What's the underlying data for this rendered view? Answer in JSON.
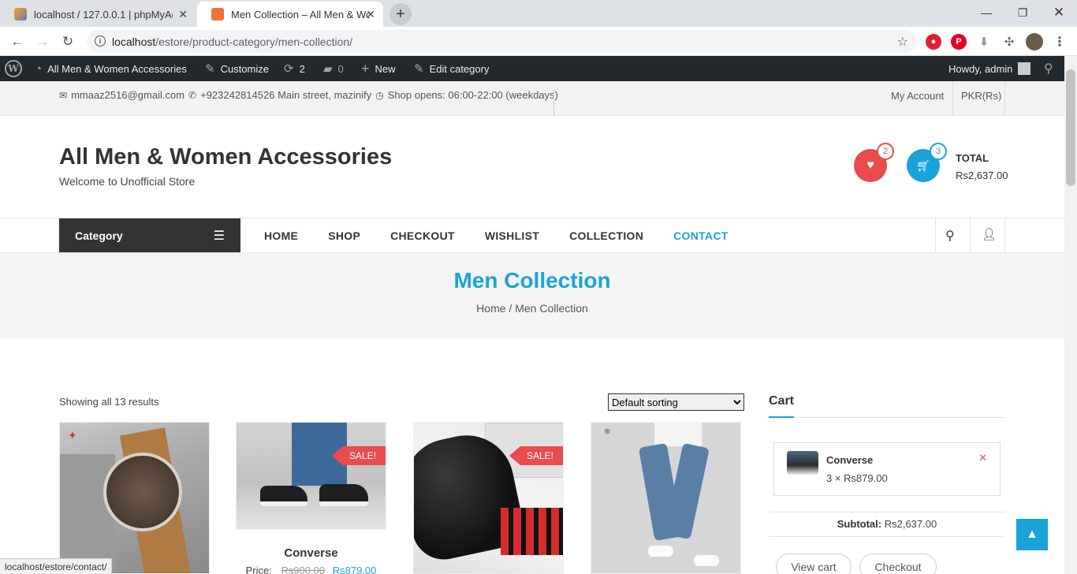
{
  "browser": {
    "tabs": [
      {
        "title": "localhost / 127.0.0.1 | phpMyAdmin",
        "active": false
      },
      {
        "title": "Men Collection – All Men & Women Accessories",
        "active": true
      }
    ],
    "url_host": "localhost",
    "url_path": "/estore/product-category/men-collection/",
    "status_url": "localhost/estore/contact/"
  },
  "adminbar": {
    "site_name": "All Men & Women Accessories",
    "customize": "Customize",
    "updates": "2",
    "comments": "0",
    "new": "New",
    "edit": "Edit category",
    "howdy": "Howdy, admin"
  },
  "topinfo": {
    "email": "mmaaz2516@gmail.com",
    "phone": "+923242814526 Main street, mazinify",
    "hours": "Shop opens: 06:00-22:00 (weekdays)",
    "account": "My Account",
    "currency": "PKR(Rs)"
  },
  "header": {
    "site_title": "All Men & Women Accessories",
    "tagline": "Welcome to Unofficial Store",
    "wishlist_count": "2",
    "cart_count": "3",
    "total_label": "TOTAL",
    "total_value": "Rs2,637.00"
  },
  "nav": {
    "category": "Category",
    "items": [
      "HOME",
      "SHOP",
      "CHECKOUT",
      "WISHLIST",
      "COLLECTION",
      "CONTACT"
    ]
  },
  "page": {
    "title": "Men Collection",
    "breadcrumb_home": "Home",
    "breadcrumb_sep": "/",
    "breadcrumb_current": "Men Collection"
  },
  "shop": {
    "results": "Showing all 13 results",
    "sort": "Default sorting",
    "sale_badge": "SALE!",
    "product2_name": "Converse",
    "product2_price_label": "Price:",
    "product2_old_price": "Rs900.00",
    "product2_new_price": "Rs879.00"
  },
  "cart_widget": {
    "heading": "Cart",
    "item_name": "Converse",
    "item_qty": "3 × Rs879.00",
    "subtotal_label": "Subtotal:",
    "subtotal_value": "Rs2,637.00",
    "view_cart": "View cart",
    "checkout": "Checkout"
  },
  "colors": {
    "accent": "#1aa3d9",
    "wish": "#e84c4c",
    "dark": "#333333",
    "adminbar": "#23282d"
  }
}
